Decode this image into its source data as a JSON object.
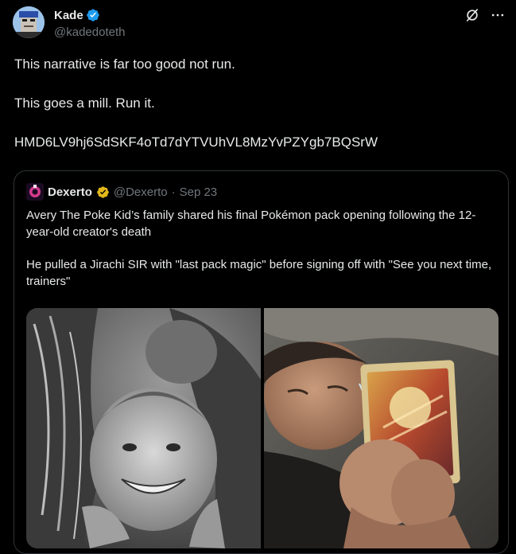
{
  "tweet": {
    "author": {
      "name": "Kade",
      "handle": "@kadedoteth",
      "verified_color": "#1d9bf0"
    },
    "paragraphs": [
      "This narrative is far too good not run.",
      "This goes a mill. Run it.",
      "HMD6LV9hj6SdSKF4oTd7dYTVUhVL8MzYvPZYgb7BQSrW"
    ],
    "icons": [
      "grok-icon",
      "more-icon"
    ],
    "quote": {
      "author": {
        "name": "Dexerto",
        "handle": "@Dexerto",
        "separator": "·",
        "date": "Sep 23",
        "verified_color": "#e2b719"
      },
      "paragraphs": [
        "Avery The Poke Kid’s family shared his final Pokémon pack opening following the 12-year-old creator's death",
        "He pulled a Jirachi SIR with \"last pack magic\" before signing off with \"See you next time, trainers\""
      ],
      "media": [
        {
          "kind": "photo",
          "tone": "black-and-white"
        },
        {
          "kind": "photo",
          "tone": "color"
        }
      ]
    }
  },
  "colors": {
    "background": "#000000",
    "text": "#e7e9ea",
    "muted": "#71767b",
    "border": "#2f3336"
  }
}
